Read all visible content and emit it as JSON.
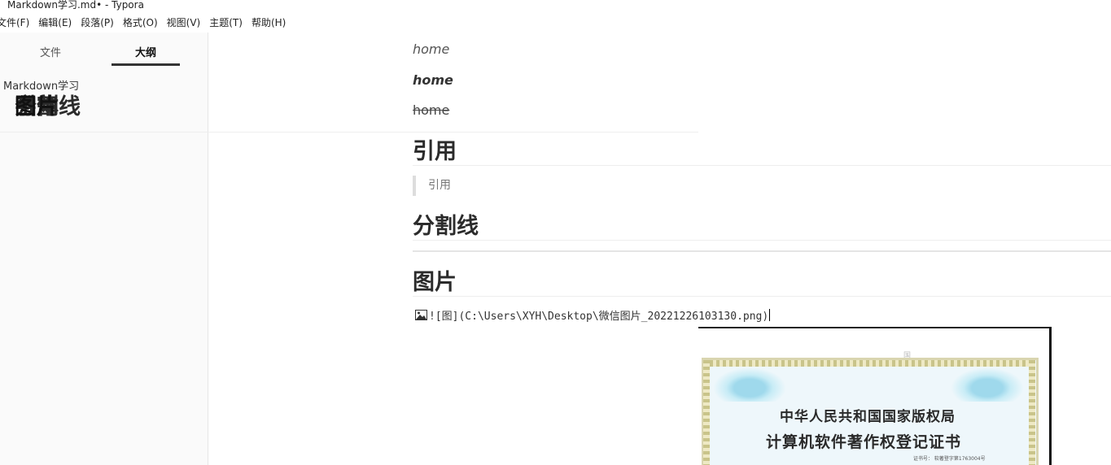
{
  "window": {
    "title": "Markdown学习.md• - Typora"
  },
  "menubar": {
    "items": [
      {
        "label": "文件(F)",
        "name": "menu-file"
      },
      {
        "label": "编辑(E)",
        "name": "menu-edit"
      },
      {
        "label": "段落(P)",
        "name": "menu-paragraph"
      },
      {
        "label": "格式(O)",
        "name": "menu-format"
      },
      {
        "label": "视图(V)",
        "name": "menu-view"
      },
      {
        "label": "主题(T)",
        "name": "menu-theme"
      },
      {
        "label": "帮助(H)",
        "name": "menu-help"
      }
    ]
  },
  "sidebar": {
    "tabs": {
      "files": "文件",
      "outline": "大纲",
      "active": "outline"
    },
    "outline": [
      {
        "label": "Markdown学习",
        "level": 1,
        "active": false
      },
      {
        "label": "字体",
        "level": 2,
        "active": false
      },
      {
        "label": "引用",
        "level": 2,
        "active": false
      },
      {
        "label": "分割线",
        "level": 2,
        "active": false
      },
      {
        "label": "图片",
        "level": 2,
        "active": true
      }
    ]
  },
  "document": {
    "italic_text": "home",
    "bold_italic_text": "home",
    "strike_text": "home",
    "heading_quote": "引用",
    "blockquote_text": "引用",
    "heading_hr": "分割线",
    "heading_image": "图片",
    "image_source": "![图](C:\\Users\\XYH\\Desktop\\微信图片_20221226103130.png)",
    "image_icon": "image-icon"
  },
  "certificate_image": {
    "line1": "中华人民共和国国家版权局",
    "line2": "计算机软件著作权登记证书",
    "number": "证书号： 软著登字第1763004号",
    "seal": "国"
  },
  "colors": {
    "sidebar_bg": "#fafafa",
    "tab_underline": "#333333",
    "heading": "#2b2b2b",
    "quote_border": "#dddddd"
  }
}
